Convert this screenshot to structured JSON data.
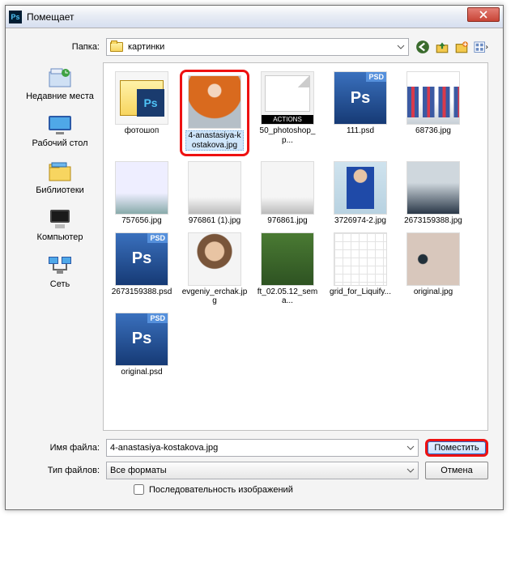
{
  "titlebar": {
    "title": "Помещает",
    "ps_icon": "Ps"
  },
  "folder_row": {
    "label": "Папка:",
    "value": "картинки"
  },
  "sidebar": {
    "items": [
      {
        "label": "Недавние места"
      },
      {
        "label": "Рабочий стол"
      },
      {
        "label": "Библиотеки"
      },
      {
        "label": "Компьютер"
      },
      {
        "label": "Сеть"
      }
    ]
  },
  "files": [
    {
      "name": "фотошоп",
      "type": "folder"
    },
    {
      "name": "4-anastasiya-kostakova.jpg",
      "type": "photo",
      "cls": "p1",
      "selected": true
    },
    {
      "name": "50_photoshop_p...",
      "type": "atn",
      "atn_label": "ACTIONS"
    },
    {
      "name": "111.psd",
      "type": "psd"
    },
    {
      "name": "68736.jpg",
      "type": "photo",
      "cls": "p-grp"
    },
    {
      "name": "757656.jpg",
      "type": "photo",
      "cls": "p-ppl"
    },
    {
      "name": "976861 (1).jpg",
      "type": "photo",
      "cls": "p-sit"
    },
    {
      "name": "976861.jpg",
      "type": "photo",
      "cls": "p-sit"
    },
    {
      "name": "3726974-2.jpg",
      "type": "photo",
      "cls": "p-guy"
    },
    {
      "name": "2673159388.jpg",
      "type": "photo",
      "cls": "p-car"
    },
    {
      "name": "2673159388.psd",
      "type": "psd"
    },
    {
      "name": "evgeniy_erchak.jpg",
      "type": "photo",
      "cls": "p-face2"
    },
    {
      "name": "ft_02.05.12_sema...",
      "type": "photo",
      "cls": "p-fam"
    },
    {
      "name": "grid_for_Liquify...",
      "type": "photo",
      "cls": "p-grid"
    },
    {
      "name": "original.jpg",
      "type": "photo",
      "cls": "p-eyes"
    },
    {
      "name": "original.psd",
      "type": "psd",
      "truncated": true
    }
  ],
  "bottom": {
    "filename_label": "Имя файла:",
    "filename_value": "4-anastasiya-kostakova.jpg",
    "filetype_label": "Тип файлов:",
    "filetype_value": "Все форматы",
    "place_btn": "Поместить",
    "cancel_btn": "Отмена",
    "sequence_check": "Последовательность изображений"
  },
  "psd_badge": "Ps"
}
